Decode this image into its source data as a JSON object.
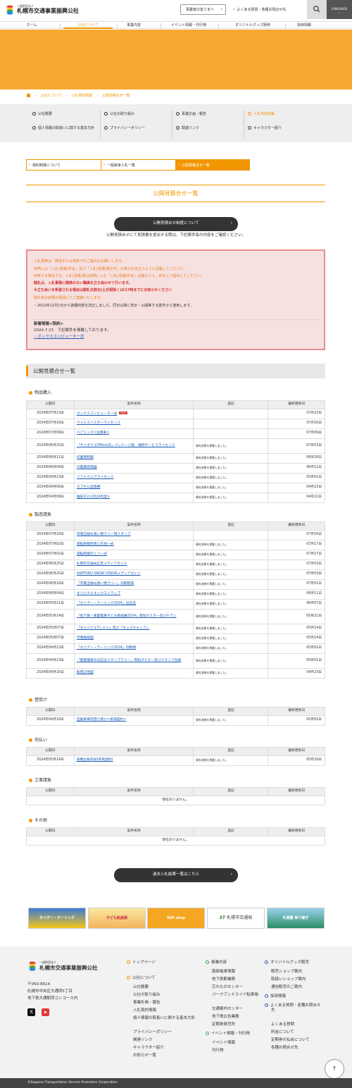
{
  "header": {
    "org_sub": "一般財団法人",
    "org_name": "札幌市交通事業振興公社",
    "btn_business": "事業者の皆さまへ",
    "faq": "よくある質問・各種お問合せ先",
    "lang": "LANGUAGE"
  },
  "nav": [
    "ホーム",
    "公社について",
    "事業内容",
    "イベント情報・刊行物",
    "オリジナルグッズ販売",
    "採用情報"
  ],
  "breadcrumb": [
    "公社について",
    "入札契約情報",
    "公開見積合せ一覧"
  ],
  "subnav": [
    "公社概要",
    "公社の取り組み",
    "事業計画・報告",
    "入札契約情報",
    "個人情報の取扱いに関する基本方針",
    "プライバシーポリシー",
    "関連リンク",
    "キャラクター紹介"
  ],
  "tabs": [
    "契約制度について",
    "一般競争入札一覧",
    "公開見積合せ一覧"
  ],
  "page_title": "公開見積合せ一覧",
  "system_btn": "公開見積合せ制度について",
  "intro": "公開見積合せにて見積書を提出する際は、下記案件毎の内容をご確認ください。",
  "notice": {
    "lines": [
      "入札書等は、郵送または持参でのご提出をお願いします。",
      "封筒には「入札(見積)件名」及び「入札(見積)書在中」の表示を目立つように記載してください。",
      "持参する場合でも、入札(見積)書は封筒に入れ「入札(見積)件名」記載のうえ、封をして提出してください。",
      "開札は、入札事務に関係のない職員を立ち会わせて行います。",
      "※立ち会いを希望される場合は開札日前日(土日祝除く)の17時までにお知らせください",
      "開札後の結果は電話にてご連絡いたします。",
      "・2022年12月1日から各種約款を改正しました。同日以降に告示・公開等する案件から適用します。"
    ],
    "news_title": "新着情報<契約>",
    "news_date": "2024.7.23　下記案件を掲載しております。",
    "news_link": "・ボックスコンピューター式"
  },
  "list_title": "公開見積合せ一覧",
  "headers": [
    "公開日",
    "案件名称",
    "追記",
    "最終更新日"
  ],
  "result_note": "開札結果を掲載しました。",
  "empty": "現在ありません。",
  "sections": [
    {
      "name": "物品購入",
      "rows": [
        [
          "2024年07月23日",
          "ボックスコンピューター式",
          "",
          "07月23日"
        ],
        [
          "2024年07月16日",
          "ウイルスバスターライセンス",
          "",
          "07月16日"
        ],
        [
          "2024年07月09日",
          "ベアリング<主要車>",
          "",
          "07月09日"
        ],
        [
          "2024年06月25日",
          "「サイボウズOffice10」パッケージ版　継続サービスライセンス",
          "開札結果を掲載しました。",
          "07月03日"
        ],
        [
          "2024年06月11日",
          "作業用制服",
          "開札結果を掲載しました。",
          "06月18日"
        ],
        [
          "2024年06月04日",
          "冷蔵庫修繕器",
          "開札結果を掲載しました。",
          "06月11日"
        ],
        [
          "2024年04月23日",
          "ソフトウェアライセンス",
          "開札結果を掲載しました。",
          "05月01日"
        ],
        [
          "2024年04月09日",
          "カプセル自販機",
          "開札結果を掲載しました。",
          "04月23日"
        ],
        [
          "2024年04月09日",
          "推知子2<2024年度>",
          "開札結果を掲載しました。",
          "04月22日"
        ]
      ]
    },
    {
      "name": "製造請負",
      "rows": [
        [
          "2024年07月16日",
          "市電沿線お買い物ラリー用スタンプ",
          "",
          "07月16日"
        ],
        [
          "2024年07月02日",
          "運転制服修繕上衣他一式",
          "開札結果を掲載しました。",
          "07月17日"
        ],
        [
          "2024年07月02日",
          "運転制服外とう一式",
          "開札結果を掲載しました。",
          "07月17日"
        ],
        [
          "2024年06月25日",
          "札幌市交通局広告メディアガイド",
          "開札結果を掲載しました。",
          "07月03日"
        ],
        [
          "2024年06月25日",
          "SAPPORO SNOW VISIONメディアガイド",
          "開札結果を掲載しました。",
          "07月03日"
        ],
        [
          "2024年06月18日",
          "「市電沿線お買い物ラリー」印刷物等",
          "開札結果を掲載しました。",
          "07月01日"
        ],
        [
          "2024年06月04日",
          "オリジナルネックストラップ",
          "開札結果を掲載しました。",
          "06月11日"
        ],
        [
          "2024年05月21日",
          "「ホリデー・テーリング2024」記念品",
          "開札結果を掲載しました。",
          "06月07日"
        ],
        [
          "2024年05月14日",
          "「地下鉄・路面電車子ども絵画展2024」周知ポスター及びチラシ",
          "開札結果を掲載しました。",
          "05月21日"
        ],
        [
          "2024年05月07日",
          "「オリジナルTシャツ」及び「キッズキャップ」",
          "開札結果を掲載しました。",
          "05月14日"
        ],
        [
          "2024年05月07日",
          "市電路線図",
          "開札結果を掲載しました。",
          "05月14日"
        ],
        [
          "2024年04月23日",
          "「ホリデー・テーリング2024」印刷物",
          "開札結果を掲載しました。",
          "05月01日"
        ],
        [
          "2024年04月23日",
          "「路面電車の日記念スタンプラリー」周知ポスター及びスタンプ台紙",
          "開札結果を掲載しました。",
          "05月01日"
        ],
        [
          "2024年04月16日",
          "駅周辺地図",
          "開札結果を掲載しました。",
          "04月23日"
        ]
      ]
    },
    {
      "name": "借受け",
      "rows": [
        [
          "2024年04月16日",
          "自動車車両借り受け<単価契約>",
          "開札結果を掲載しました。",
          "05月02日"
        ]
      ]
    },
    {
      "name": "売払い",
      "rows": [
        [
          "2024年05月14日",
          "各種古紙売却(単価契約)",
          "開札結果を掲載しました。",
          "05月29日"
        ]
      ]
    },
    {
      "name": "工事請負",
      "rows": []
    },
    {
      "name": "その他",
      "rows": []
    }
  ],
  "past_btn": "過去入札結果一覧はこちら",
  "banners": [
    "ホリデー・テーリング",
    "子ども絵画展",
    "SSP shop",
    "札幌市交通局",
    "札幌圏 乗り継ぎ"
  ],
  "footer": {
    "org_sub": "一般財団法人",
    "org_name": "札幌市交通事業振興公社",
    "addr": [
      "〒060-8614",
      "札幌市中央区大通西5丁目",
      "地下鉄大通駅西コンコース内"
    ],
    "col1": {
      "h1": "トップページ",
      "h2": "公社について",
      "items": [
        "公社概要",
        "公社の取り組み",
        "事業計画・報告",
        "入札契約情報",
        "個人情報の取扱いに関する基本方針",
        "プライバシーポリシー",
        "関連リンク",
        "キャラクター紹介",
        "お知らせ一覧"
      ]
    },
    "col2": {
      "h1": "事業内容",
      "items": [
        "路面電車情報",
        "地下鉄駅業務",
        "忘れものセンター",
        "パークアンドライド駐車場",
        "交通案内センター",
        "地下鉄広告業務",
        "定期券発売所"
      ],
      "h2": "イベント情報・刊行物",
      "items2": [
        "イベント情報",
        "刊行物"
      ]
    },
    "col3": {
      "h1": "オリジナルグッズ販売",
      "items": [
        "販売ショップ案内",
        "取扱いショップ案内",
        "通信販売のご案内"
      ],
      "h2": "採用情報",
      "h3": "よくある質問・各種お問合せ先",
      "items3": [
        "よくある質問",
        "料金について",
        "定期券の払戻について",
        "各種お問合せ先"
      ]
    },
    "copyright": "©Sapporo Transportation Service Promotion Corporation."
  },
  "colors": {
    "accent": "#f29600",
    "hero": "#f7a830",
    "notice_bg": "#f7e1e0",
    "notice_border": "#e98d8d"
  }
}
